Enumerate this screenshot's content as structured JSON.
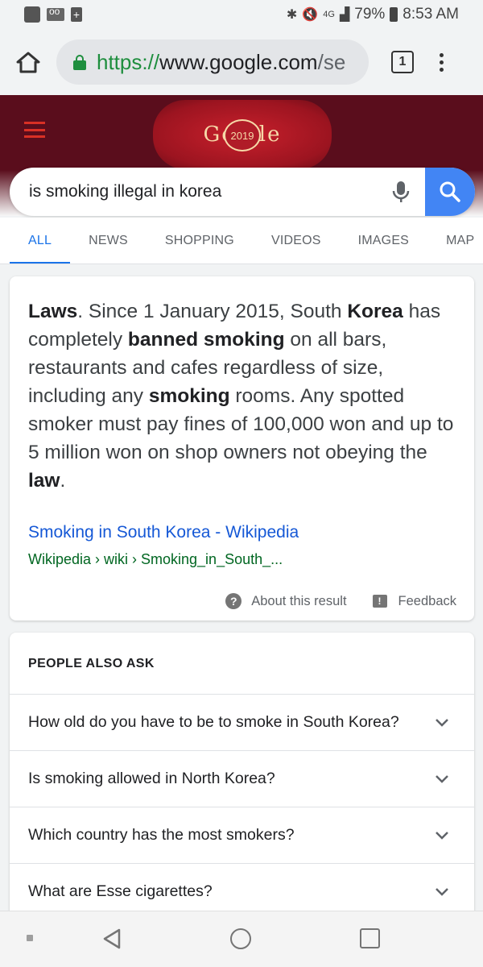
{
  "status_bar": {
    "battery": "79%",
    "time": "8:53 AM"
  },
  "browser": {
    "url_scheme": "https://",
    "url_host": "www.google.com",
    "url_rest": "/se",
    "tab_count": "1"
  },
  "doodle": {
    "text": "Go    gle",
    "year": "2019"
  },
  "search": {
    "query": "is smoking illegal in korea"
  },
  "tabs": [
    "ALL",
    "NEWS",
    "SHOPPING",
    "VIDEOS",
    "IMAGES",
    "MAP"
  ],
  "snippet": {
    "parts": [
      {
        "t": "Laws",
        "b": true
      },
      {
        "t": ". Since 1 January 2015, South ",
        "b": false
      },
      {
        "t": "Korea",
        "b": true
      },
      {
        "t": " has completely ",
        "b": false
      },
      {
        "t": "banned smoking",
        "b": true
      },
      {
        "t": " on all bars, restaurants and cafes regardless of size, including any ",
        "b": false
      },
      {
        "t": "smoking",
        "b": true
      },
      {
        "t": " rooms. Any spotted smoker must pay fines of 100,000 won and up to 5 million won on shop owners not obeying the ",
        "b": false
      },
      {
        "t": "law",
        "b": true
      },
      {
        "t": ".",
        "b": false
      }
    ],
    "link_title": "Smoking in South Korea - Wikipedia",
    "cite": "Wikipedia › wiki › Smoking_in_South_...",
    "about_label": "About this result",
    "feedback_label": "Feedback"
  },
  "people_also_ask": {
    "title": "PEOPLE ALSO ASK",
    "questions": [
      "How old do you have to be to smoke in South Korea?",
      "Is smoking allowed in North Korea?",
      "Which country has the most smokers?",
      "What are Esse cigarettes?"
    ]
  },
  "icons": {
    "status_left": [
      "app-icon",
      "voicemail-icon",
      "plus-icon"
    ],
    "status_right": [
      "bluetooth-icon",
      "mute-icon",
      "4g-icon",
      "signal-icon",
      "battery-icon"
    ]
  },
  "colors": {
    "accent_blue": "#1a73e8",
    "header_maroon": "#5a0d1c",
    "link_blue": "#1558d6",
    "cite_green": "#006621",
    "secure_green": "#1e8e3e"
  }
}
